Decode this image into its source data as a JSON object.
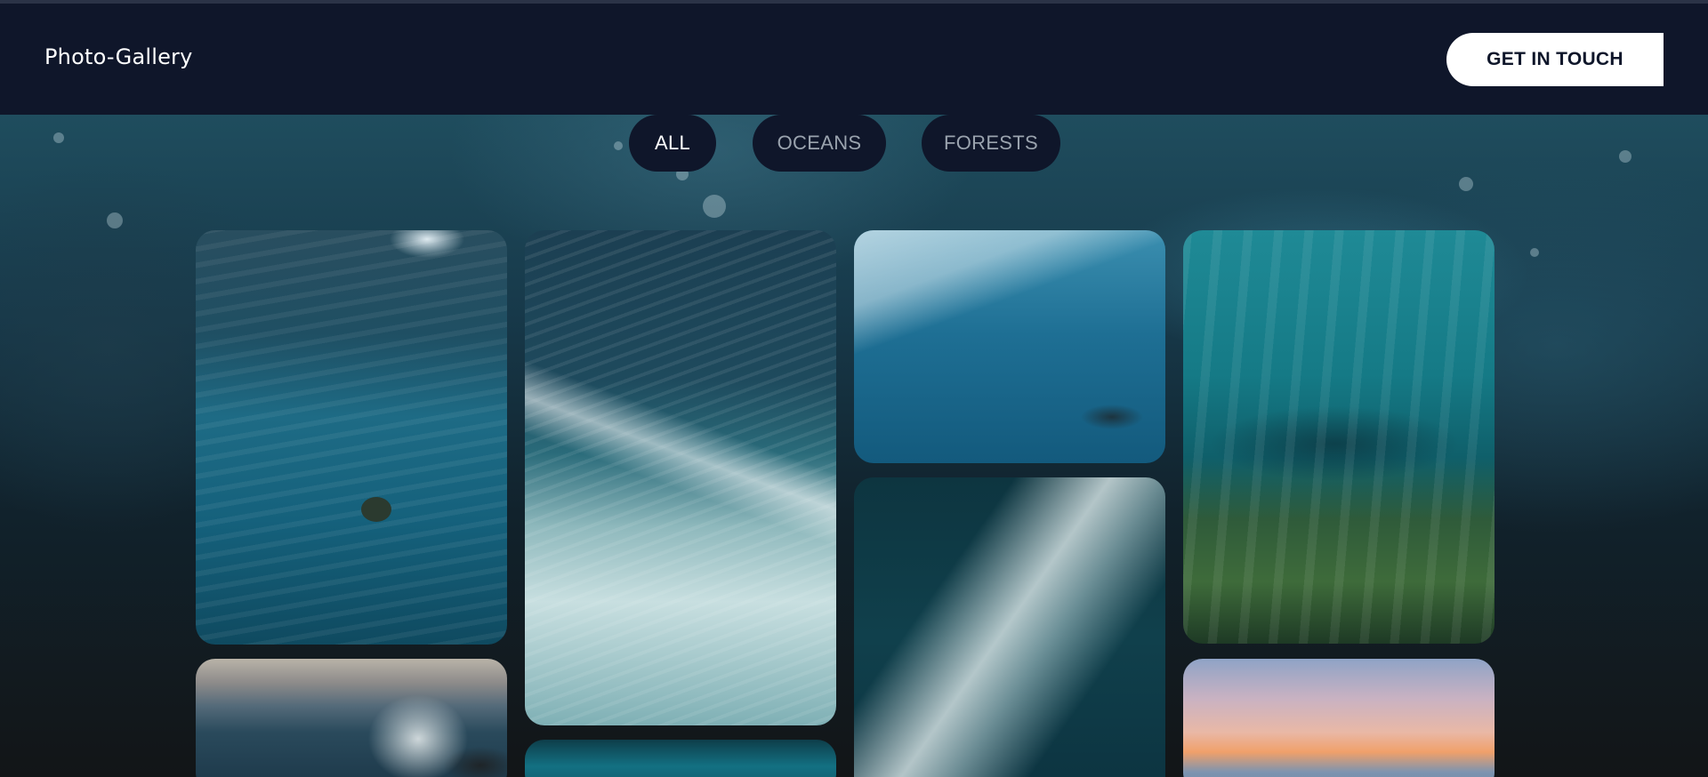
{
  "navbar": {
    "brand": "Photo-Gallery",
    "cta_label": "GET IN TOUCH"
  },
  "filters": {
    "items": [
      {
        "label": "ALL",
        "active": true
      },
      {
        "label": "OCEANS",
        "active": false
      },
      {
        "label": "FORESTS",
        "active": false
      }
    ]
  },
  "gallery": {
    "photos": [
      {
        "subject": "sea turtle swimming underwater"
      },
      {
        "subject": "aerial view of breaking wave"
      },
      {
        "subject": "plastic waste floating in ocean"
      },
      {
        "subject": "sunlight over coral reef with fish"
      },
      {
        "subject": "wave crashing on rocks at sunset"
      },
      {
        "subject": "turquoise ocean water"
      },
      {
        "subject": "aerial view of white surf on dark water"
      },
      {
        "subject": "pastel sunset over the sea"
      }
    ]
  },
  "colors": {
    "nav_background": "#0f162a",
    "cta_background": "#ffffff",
    "pill_background": "#0f162a",
    "pill_active_text": "#ffffff",
    "pill_inactive_text": "#9aa3ae"
  }
}
